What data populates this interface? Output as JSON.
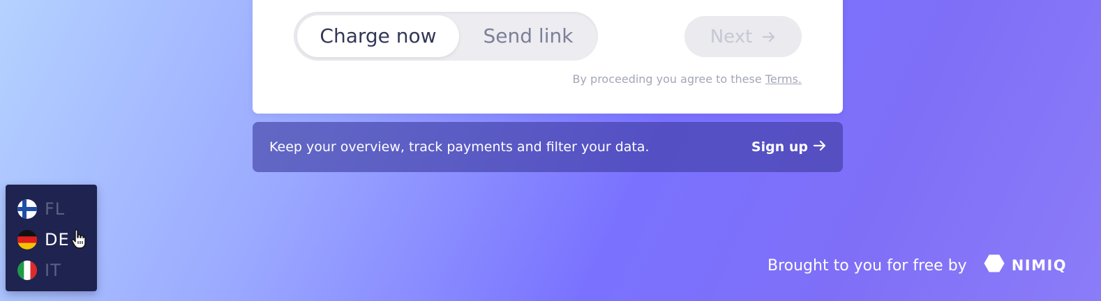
{
  "payment_card": {
    "mode_toggle": {
      "options": [
        {
          "label": "Charge now",
          "active": true
        },
        {
          "label": "Send link",
          "active": false
        }
      ]
    },
    "next_button": {
      "label": "Next",
      "icon": "arrow-right-icon",
      "enabled": false
    },
    "terms": {
      "prefix": "By proceeding you agree to these",
      "link_label": "Terms."
    }
  },
  "signup_banner": {
    "text": "Keep your overview, track payments and filter your data.",
    "link_label": "Sign up",
    "icon": "arrow-right-icon"
  },
  "language_menu": {
    "items": [
      {
        "code": "FL",
        "flag": "finland-flag-icon",
        "highlighted": false
      },
      {
        "code": "DE",
        "flag": "germany-flag-icon",
        "highlighted": true
      },
      {
        "code": "IT",
        "flag": "italy-flag-icon",
        "highlighted": false
      }
    ]
  },
  "footer": {
    "brought_by": "Brought to you for free by",
    "brand": "NIMIQ",
    "logo_icon": "nimiq-hexagon-icon"
  },
  "colors": {
    "card_bg": "#ffffff",
    "menu_bg": "#1f2350",
    "banner_bg": "#4f4cb0",
    "text_dark": "#323756"
  }
}
